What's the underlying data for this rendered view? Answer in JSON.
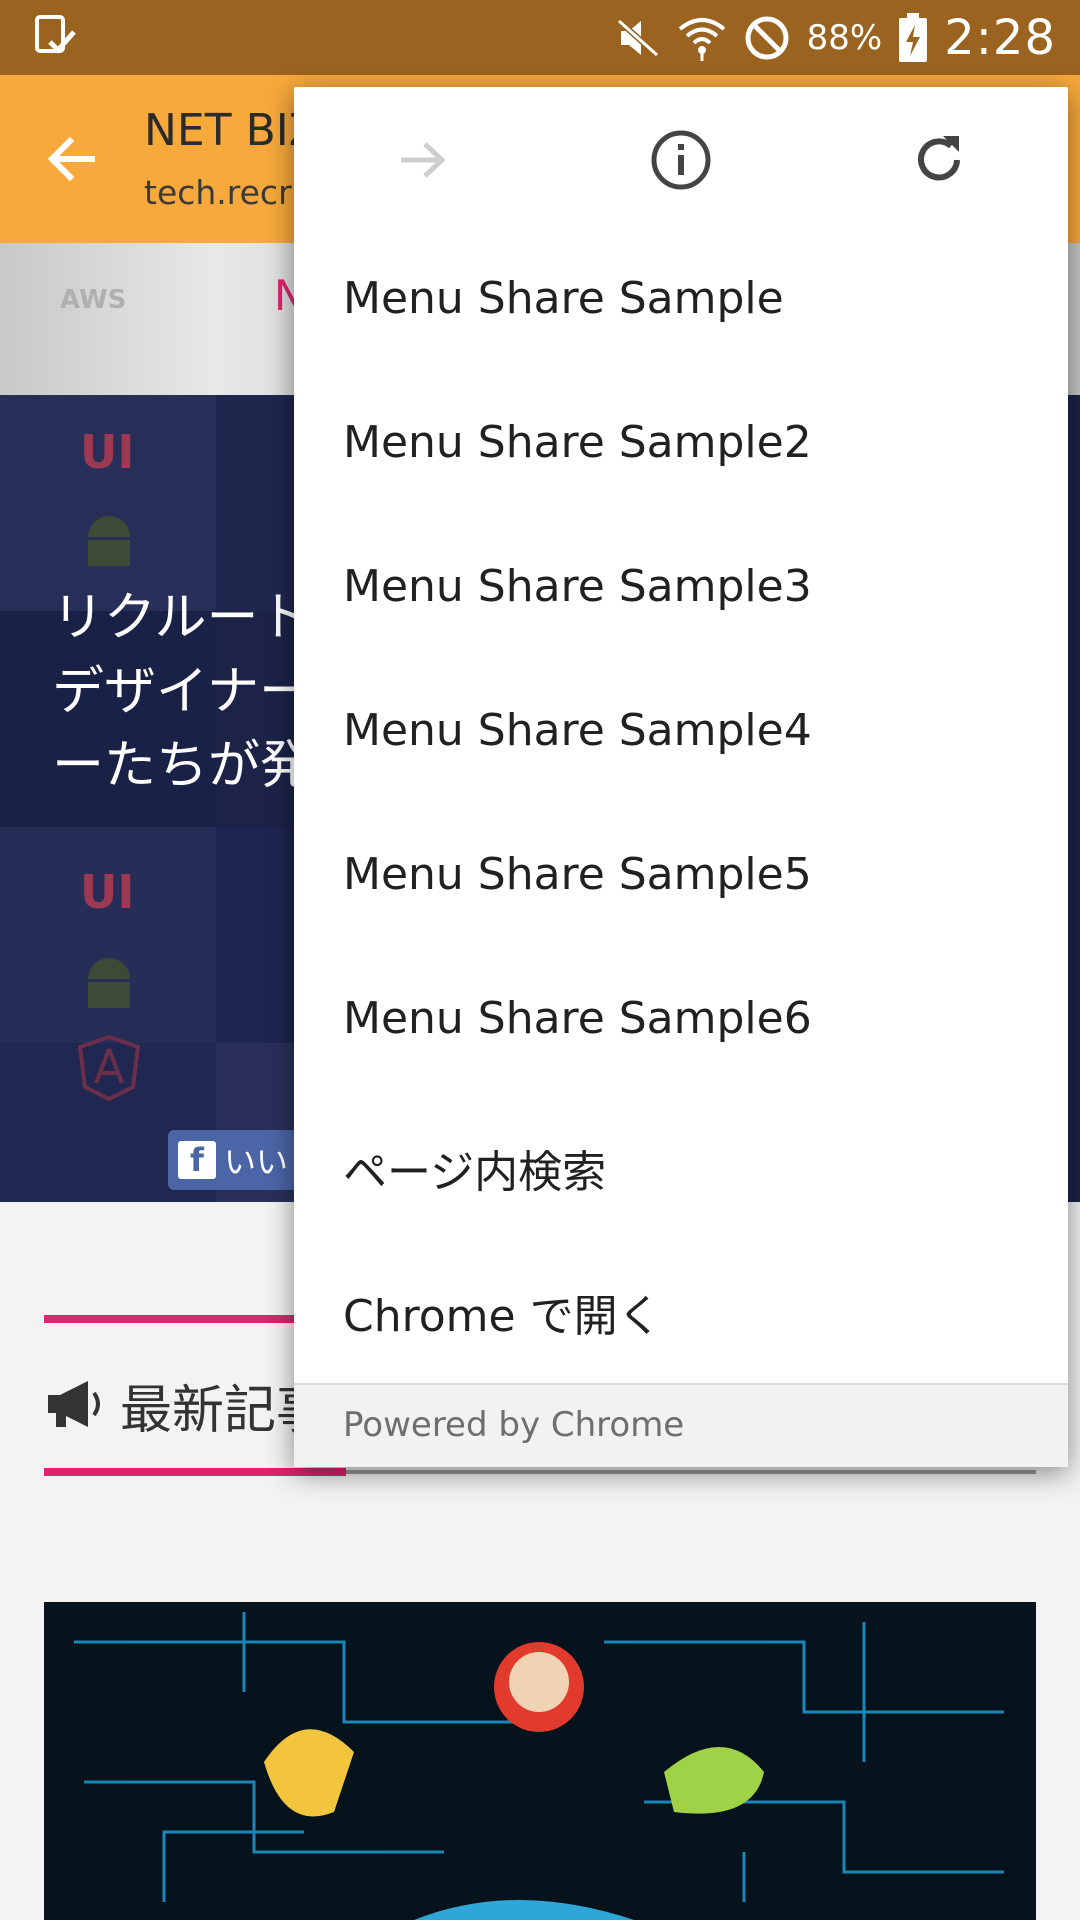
{
  "status_bar": {
    "battery_percent": "88%",
    "time": "2:28",
    "icons": [
      "download-complete-icon",
      "mute-icon",
      "wifi-icon",
      "do-not-disturb-icon",
      "battery-charging-icon"
    ]
  },
  "toolbar": {
    "title": "NET BIZ",
    "url": "tech.recru"
  },
  "page": {
    "banner_aws_text": "AWS",
    "banner_pink_text": "N",
    "hero_lines": [
      "リクルート",
      "デザイナー",
      "ーたちが発"
    ],
    "fb_like_label": "いい",
    "section_title": "最新記事"
  },
  "menu": {
    "icons": [
      "forward-icon",
      "info-icon",
      "reload-icon"
    ],
    "items": [
      "Menu Share Sample",
      "Menu Share Sample2",
      "Menu Share Sample3",
      "Menu Share Sample4",
      "Menu Share Sample5",
      "Menu Share Sample6",
      "ページ内検索",
      "Chrome で開く"
    ],
    "footer": "Powered by Chrome"
  },
  "colors": {
    "status_bar": "#9a6420",
    "toolbar": "#f7a93b",
    "accent_pink": "#e0246e"
  }
}
